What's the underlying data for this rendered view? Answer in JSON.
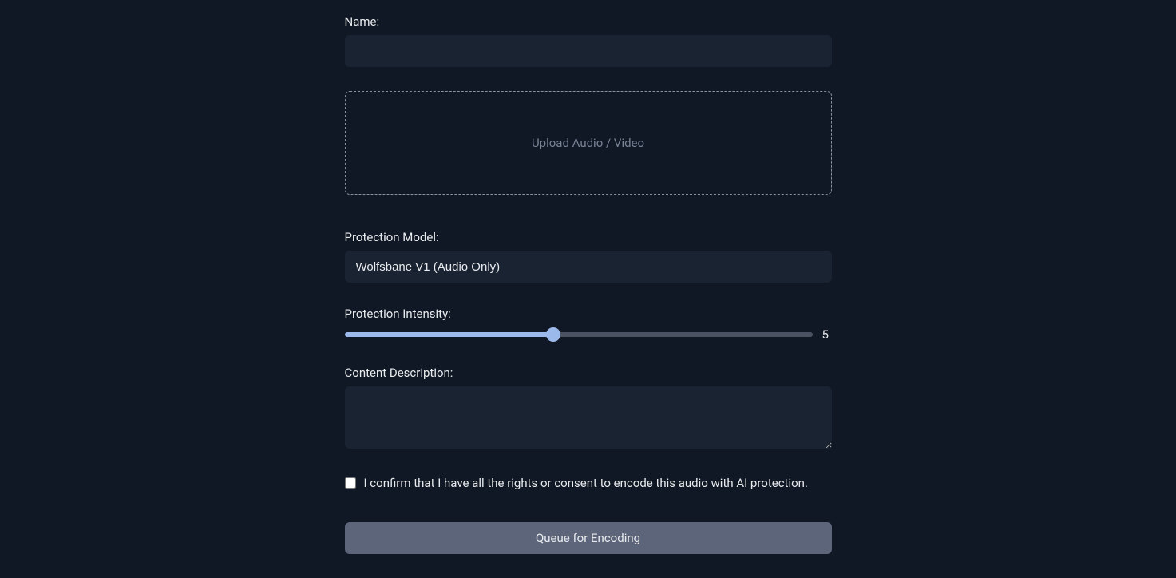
{
  "form": {
    "name": {
      "label": "Name:",
      "value": ""
    },
    "upload": {
      "text": "Upload Audio / Video"
    },
    "protection_model": {
      "label": "Protection Model:",
      "selected": "Wolfsbane V1 (Audio Only)"
    },
    "protection_intensity": {
      "label": "Protection Intensity:",
      "value": "5",
      "min": "1",
      "max": "10"
    },
    "content_description": {
      "label": "Content Description:",
      "value": ""
    },
    "consent": {
      "label": "I confirm that I have all the rights or consent to encode this audio with AI protection."
    },
    "submit": {
      "label": "Queue for Encoding"
    }
  }
}
